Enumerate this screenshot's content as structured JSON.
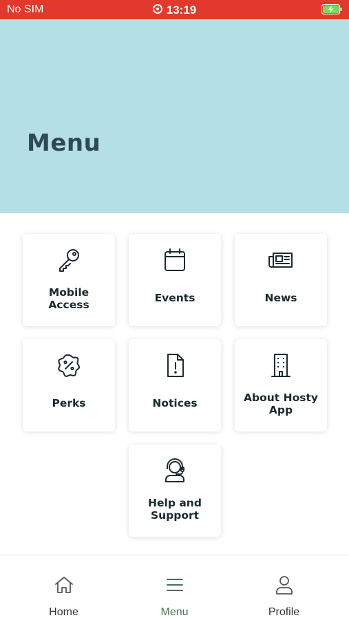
{
  "status_bar": {
    "carrier": "No SIM",
    "time": "13:19"
  },
  "header": {
    "title": "Menu"
  },
  "tiles": [
    {
      "label": "Mobile Access",
      "icon": "key-icon"
    },
    {
      "label": "Events",
      "icon": "calendar-icon"
    },
    {
      "label": "News",
      "icon": "newspaper-icon"
    },
    {
      "label": "Perks",
      "icon": "percent-badge-icon"
    },
    {
      "label": "Notices",
      "icon": "document-alert-icon"
    },
    {
      "label": "About Hosty App",
      "icon": "building-icon"
    },
    {
      "label": "Help and Support",
      "icon": "support-agent-icon"
    }
  ],
  "tab_bar": {
    "items": [
      {
        "label": "Home",
        "icon": "home-icon",
        "active": false
      },
      {
        "label": "Menu",
        "icon": "menu-icon",
        "active": true
      },
      {
        "label": "Profile",
        "icon": "profile-icon",
        "active": false
      }
    ]
  },
  "colors": {
    "status_bar": "#e1392b",
    "hero_background": "#b4e0e5",
    "title_text": "#2f4858",
    "active_tab": "#4a6f5a"
  }
}
